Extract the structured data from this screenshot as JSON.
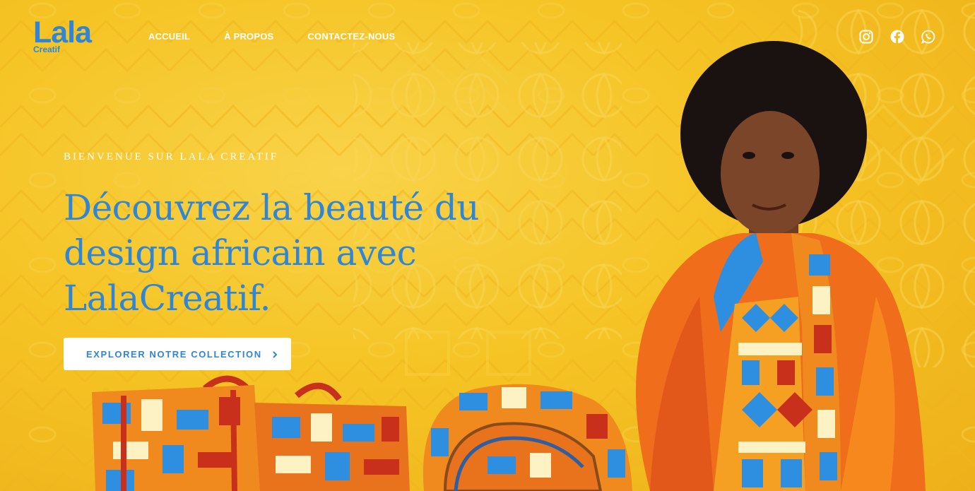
{
  "brand": {
    "logo_main": "Lala",
    "logo_sub": "Creatif",
    "color": "#2f86d6"
  },
  "nav": {
    "items": [
      {
        "label": "ACCUEIL"
      },
      {
        "label": "À PROPOS"
      },
      {
        "label": "CONTACTEZ-NOUS"
      }
    ]
  },
  "social": {
    "icons": [
      "instagram-icon",
      "facebook-icon",
      "whatsapp-icon"
    ]
  },
  "hero": {
    "eyebrow": "BIENVENUE SUR LALA CREATIF",
    "headline_line1": "Découvrez la beauté du",
    "headline_line2": "design africain avec",
    "headline_line3": "LalaCreatif.",
    "cta_label": "EXPLORER NOTRE COLLECTION",
    "background": "#f5c424",
    "accent": "#2f86d6"
  }
}
